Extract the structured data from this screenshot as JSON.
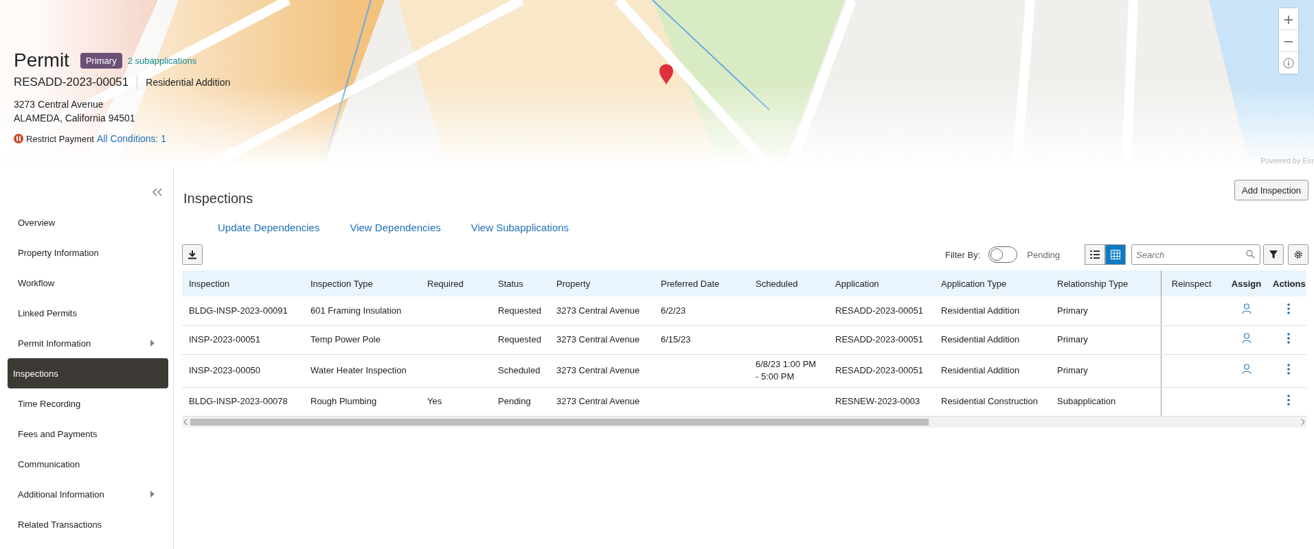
{
  "header": {
    "title": "Permit",
    "badge": "Primary",
    "subapplications_link": "2 subapplications",
    "record_id": "RESADD-2023-00051",
    "record_type": "Residential Addition",
    "address_line_1": "3273 Central Avenue",
    "address_line_2": "ALAMEDA, California 94501",
    "restriction": "Restrict Payment",
    "conditions_link": "All Conditions: 1"
  },
  "map": {
    "kind": "picture",
    "controls": [
      "+",
      "−"
    ],
    "attribution": "Powered by Esr"
  },
  "sidebar": {
    "items": [
      {
        "label": "Overview",
        "selected": false,
        "has_submenu": false
      },
      {
        "label": "Property Information",
        "selected": false,
        "has_submenu": false
      },
      {
        "label": "Workflow",
        "selected": false,
        "has_submenu": false
      },
      {
        "label": "Linked Permits",
        "selected": false,
        "has_submenu": false
      },
      {
        "label": "Permit Information",
        "selected": false,
        "has_submenu": true
      },
      {
        "label": "Inspections",
        "selected": true,
        "has_submenu": false
      },
      {
        "label": "Time Recording",
        "selected": false,
        "has_submenu": false
      },
      {
        "label": "Fees and Payments",
        "selected": false,
        "has_submenu": false
      },
      {
        "label": "Communication",
        "selected": false,
        "has_submenu": false
      },
      {
        "label": "Additional Information",
        "selected": false,
        "has_submenu": true
      },
      {
        "label": "Related Transactions",
        "selected": false,
        "has_submenu": false
      }
    ]
  },
  "page": {
    "title": "Inspections",
    "add_button": "Add Inspection",
    "links": [
      "Update Dependencies",
      "View Dependencies",
      "View Subapplications"
    ]
  },
  "toolbar": {
    "filter_label": "Filter By:",
    "filter_on": false,
    "filter_option": "Pending",
    "views": [
      {
        "kind": "list",
        "selected": false
      },
      {
        "kind": "grid",
        "selected": true
      }
    ],
    "search": {
      "placeholder": "Search"
    }
  },
  "table": {
    "columns": [
      "Inspection",
      "Inspection Type",
      "Required",
      "Status",
      "Property",
      "Preferred Date",
      "Scheduled",
      "Application",
      "Application Type",
      "Relationship Type",
      "Reinspect",
      "Assign",
      "Actions"
    ],
    "rows": [
      {
        "cells": [
          "BLDG-INSP-2023-00091",
          "601 Framing Insulation",
          "",
          "Requested",
          "3273 Central Avenue",
          "6/2/23",
          "",
          "RESADD-2023-00051",
          "Residential Addition",
          "Primary",
          ""
        ],
        "assign": true
      },
      {
        "cells": [
          "INSP-2023-00051",
          "Temp Power Pole",
          "",
          "Requested",
          "3273 Central Avenue",
          "6/15/23",
          "",
          "RESADD-2023-00051",
          "Residential Addition",
          "Primary",
          ""
        ],
        "assign": true
      },
      {
        "cells": [
          "INSP-2023-00050",
          "Water Heater Inspection",
          "",
          "Scheduled",
          "3273 Central Avenue",
          "",
          "6/8/23 1:00 PM - 5:00 PM",
          "RESADD-2023-00051",
          "Residential Addition",
          "Primary",
          ""
        ],
        "assign": true
      },
      {
        "cells": [
          "BLDG-INSP-2023-00078",
          "Rough Plumbing",
          "Yes",
          "Pending",
          "3273 Central Avenue",
          "",
          "",
          "RESNEW-2023-0003",
          "Residential Construction",
          "Subapplication",
          ""
        ],
        "assign": false
      }
    ]
  }
}
